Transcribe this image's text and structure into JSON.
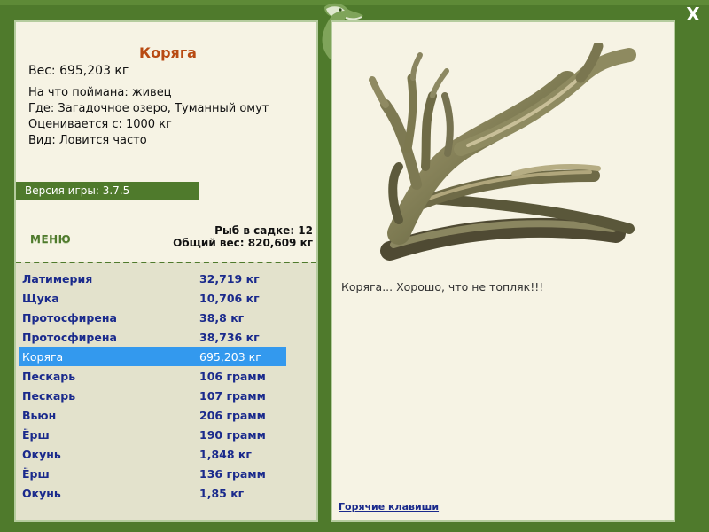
{
  "window": {
    "close_label": "X"
  },
  "fish": {
    "name": "Коряга",
    "weight": "Вес: 695,203 кг",
    "details": [
      "На что поймана: живец",
      "Где: Загадочное озеро, Туманный омут",
      "Оценивается с: 1000 кг",
      "Вид: Ловится часто"
    ],
    "comment": "Коряга... Хорошо, что не топляк!!!"
  },
  "version": "Версия игры: 3.7.5",
  "menu_label": "МЕНЮ",
  "stats": {
    "fish_in_keepnet": "Рыб в садке: 12",
    "total_weight": "Общий вес: 820,609 кг"
  },
  "catch_list": [
    {
      "name": "Латимерия",
      "weight": "32,719 кг"
    },
    {
      "name": "Щука",
      "weight": "10,706 кг"
    },
    {
      "name": "Протосфирена",
      "weight": "38,8 кг"
    },
    {
      "name": "Протосфирена",
      "weight": "38,736 кг"
    },
    {
      "name": "Коряга",
      "weight": "695,203 кг",
      "selected": true
    },
    {
      "name": "Пескарь",
      "weight": "106 грамм"
    },
    {
      "name": "Пескарь",
      "weight": "107 грамм"
    },
    {
      "name": "Вьюн",
      "weight": "206 грамм"
    },
    {
      "name": "Ёрш",
      "weight": "190 грамм"
    },
    {
      "name": "Окунь",
      "weight": "1,848 кг"
    },
    {
      "name": "Ёрш",
      "weight": "136 грамм"
    },
    {
      "name": "Окунь",
      "weight": "1,85 кг"
    }
  ],
  "hotkeys_label": "Горячие клавиши",
  "colors": {
    "frame_green": "#4f7a2c",
    "panel_bg": "#f6f3e4",
    "selected_row": "#3399ee",
    "list_text": "#1a2a8c",
    "title_text": "#b84a12"
  },
  "icons": {
    "logo": "fish-logo-icon",
    "close": "close-icon",
    "picture": "driftwood-image"
  }
}
